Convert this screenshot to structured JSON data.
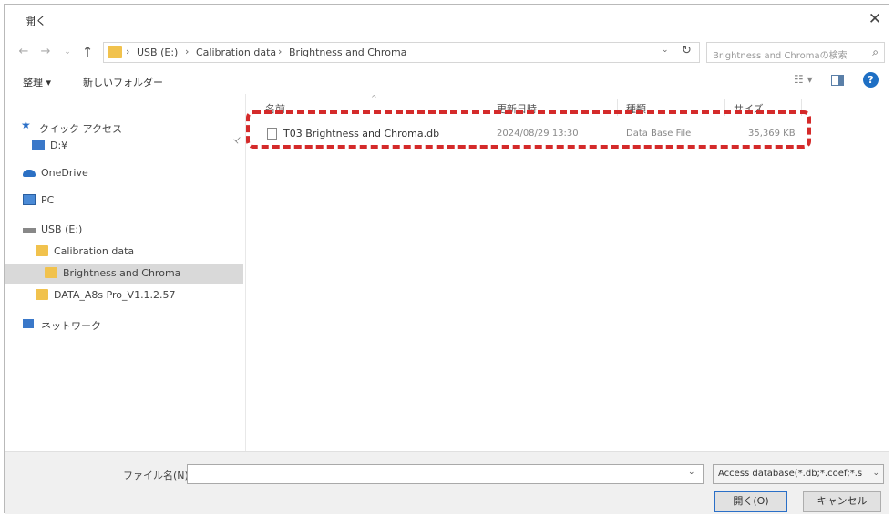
{
  "window": {
    "title": "開く",
    "close_glyph": "✕"
  },
  "nav_buttons": {
    "back": "←",
    "forward": "→",
    "history": "⌄",
    "up": "↑"
  },
  "address": {
    "crumbs": [
      "USB (E:)",
      "Calibration data",
      "Brightness and Chroma"
    ],
    "separator": "›",
    "dropdown_glyph": "⌄",
    "refresh_glyph": "↻"
  },
  "search": {
    "placeholder": "Brightness and Chromaの検索",
    "icon_glyph": "⌕"
  },
  "toolbar": {
    "organize_label": "整理 ▾",
    "new_folder_label": "新しいフォルダー",
    "view_glyph": "☷ ▾",
    "help_glyph": "?"
  },
  "sidebar": {
    "items": [
      {
        "label": "クイック アクセス",
        "icon": "star-icon"
      },
      {
        "label": "D:¥",
        "icon": "drive-icon"
      },
      {
        "label": "OneDrive",
        "icon": "cloud-icon"
      },
      {
        "label": "PC",
        "icon": "monitor-icon"
      },
      {
        "label": "USB (E:)",
        "icon": "usb-drive-icon"
      },
      {
        "label": "Calibration data",
        "icon": "folder-icon"
      },
      {
        "label": "Brightness and Chroma",
        "icon": "folder-icon",
        "selected": true
      },
      {
        "label": "DATA_A8s Pro_V1.1.2.57",
        "icon": "folder-icon"
      },
      {
        "label": "ネットワーク",
        "icon": "network-icon"
      }
    ],
    "pin_glyph": "📌"
  },
  "columns": {
    "name": "名前",
    "date": "更新日時",
    "type": "種類",
    "size": "サイズ",
    "sort_glyph": "^"
  },
  "files": [
    {
      "name": "T03 Brightness and Chroma.db",
      "date": "2024/08/29 13:30",
      "type": "Data Base File",
      "size": "35,369 KB"
    }
  ],
  "bottom": {
    "filename_label": "ファイル名(N):",
    "filename_value": "",
    "dropdown_glyph": "⌄",
    "filter_value": "Access database(*.db;*.coef;*.s",
    "open_button": "開く(O)",
    "cancel_button": "キャンセル"
  },
  "colors": {
    "highlight": "#d42a2a",
    "folder": "#f1c24d",
    "accent": "#1e6fc4"
  }
}
